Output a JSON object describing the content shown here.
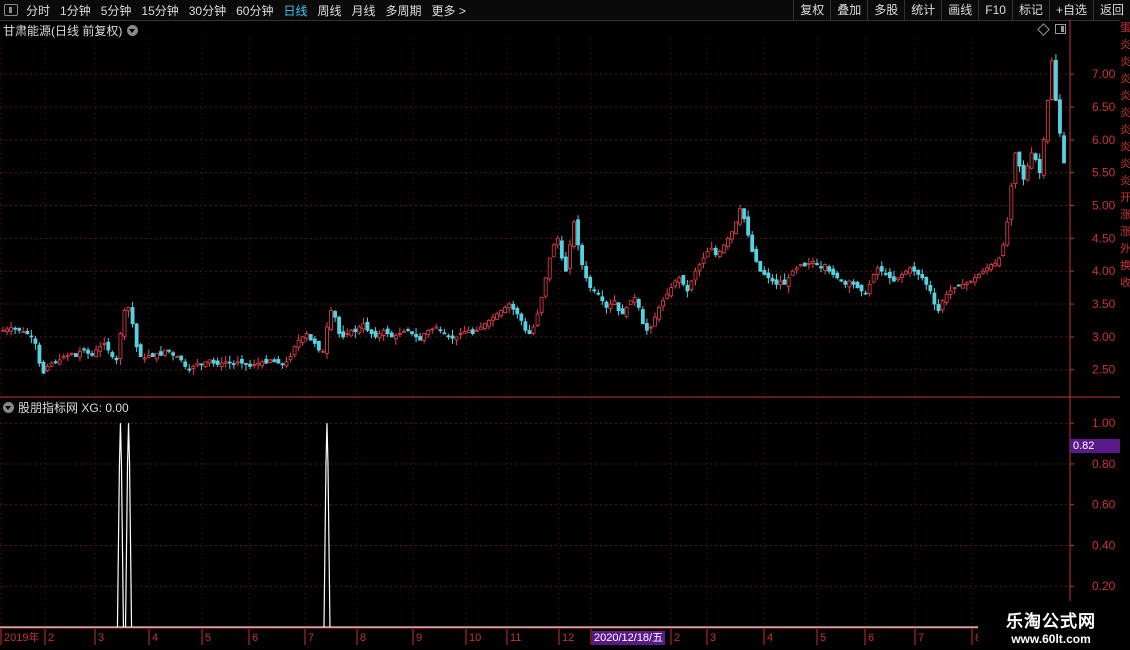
{
  "toolbar": {
    "periods": [
      "分时",
      "1分钟",
      "5分钟",
      "15分钟",
      "30分钟",
      "60分钟",
      "日线",
      "周线",
      "月线",
      "多周期",
      "更多 >"
    ],
    "active_period": "日线",
    "right_buttons": [
      "复权",
      "叠加",
      "多股",
      "统计",
      "画线",
      "F10",
      "标记",
      "+自选",
      "返回"
    ]
  },
  "main_chart": {
    "title": "甘肃能源(日线 前复权)"
  },
  "indicator": {
    "title": "股朋指标网  XG: 0.00",
    "marker_value": "0.82"
  },
  "date_highlight": "2020/12/18/五",
  "watermark": {
    "line1": "乐淘公式网",
    "line2": "www.60lt.com"
  },
  "colors": {
    "up": "#e8414a",
    "down": "#56d1e0",
    "axis": "#c83232",
    "grid": "#5a1414",
    "active_tab": "#37c8f0",
    "signal": "#ffffff"
  },
  "right_strip_chars": [
    "蛋",
    "炎",
    "炎",
    "炎",
    "炎",
    "炎",
    "炎",
    "炎",
    "炎",
    "炎",
    "开",
    "涨",
    "涨",
    "外",
    "换",
    "收"
  ],
  "chart_data": [
    {
      "type": "candlestick",
      "title": "甘肃能源(日线 前复权)",
      "y_ticks": [
        "2.50",
        "3.00",
        "3.50",
        "4.00",
        "4.50",
        "5.00",
        "5.50",
        "6.00",
        "6.50",
        "7.00"
      ],
      "ylim": [
        2.1,
        7.55
      ],
      "x_ticks": [
        "2019年",
        "2",
        "3",
        "4",
        "5",
        "6",
        "7",
        "8",
        "9",
        "10",
        "11",
        "12",
        "2020/12/18/五",
        "2",
        "3",
        "4",
        "5",
        "6",
        "7",
        "8"
      ],
      "close_path": [
        3.1,
        3.12,
        3.14,
        3.12,
        3.1,
        3.08,
        3.05,
        3.0,
        2.9,
        2.6,
        2.45,
        2.55,
        2.6,
        2.62,
        2.65,
        2.7,
        2.72,
        2.75,
        2.7,
        2.78,
        2.8,
        2.75,
        2.72,
        2.8,
        2.85,
        2.9,
        2.8,
        2.7,
        2.65,
        3.05,
        3.4,
        3.45,
        3.2,
        2.85,
        2.7,
        2.68,
        2.72,
        2.7,
        2.75,
        2.72,
        2.8,
        2.78,
        2.72,
        2.7,
        2.65,
        2.55,
        2.5,
        2.55,
        2.6,
        2.58,
        2.62,
        2.65,
        2.6,
        2.58,
        2.6,
        2.62,
        2.6,
        2.58,
        2.62,
        2.6,
        2.58,
        2.55,
        2.58,
        2.6,
        2.62,
        2.6,
        2.65,
        2.62,
        2.6,
        2.58,
        2.62,
        2.7,
        2.85,
        2.95,
        3.0,
        3.05,
        2.95,
        2.9,
        2.8,
        2.78,
        3.15,
        3.4,
        3.3,
        3.05,
        3.0,
        3.05,
        3.1,
        3.08,
        3.15,
        3.2,
        3.1,
        3.05,
        3.0,
        3.05,
        3.1,
        3.05,
        3.0,
        3.02,
        3.05,
        3.08,
        3.1,
        3.05,
        3.0,
        2.95,
        3.05,
        3.1,
        3.12,
        3.15,
        3.1,
        3.05,
        3.0,
        2.98,
        3.0,
        3.05,
        3.08,
        3.1,
        3.05,
        3.1,
        3.15,
        3.2,
        3.25,
        3.3,
        3.35,
        3.4,
        3.45,
        3.5,
        3.42,
        3.35,
        3.25,
        3.1,
        3.05,
        3.15,
        3.35,
        3.6,
        3.9,
        4.2,
        4.4,
        4.5,
        4.2,
        4.0,
        4.4,
        4.75,
        4.4,
        4.1,
        3.9,
        3.75,
        3.7,
        3.65,
        3.55,
        3.45,
        3.5,
        3.55,
        3.4,
        3.35,
        3.45,
        3.55,
        3.6,
        3.45,
        3.2,
        3.1,
        3.15,
        3.3,
        3.45,
        3.55,
        3.65,
        3.75,
        3.85,
        3.9,
        3.8,
        3.7,
        3.85,
        4.0,
        4.1,
        4.2,
        4.3,
        4.35,
        4.25,
        4.3,
        4.4,
        4.5,
        4.6,
        4.75,
        4.95,
        4.8,
        4.55,
        4.3,
        4.15,
        4.0,
        3.95,
        3.9,
        3.85,
        3.8,
        3.85,
        3.8,
        3.9,
        4.0,
        4.05,
        4.1,
        4.08,
        4.12,
        4.15,
        4.1,
        4.05,
        4.1,
        4.0,
        3.95,
        3.9,
        3.85,
        3.8,
        3.85,
        3.8,
        3.75,
        3.7,
        3.65,
        3.8,
        3.95,
        4.05,
        4.0,
        3.95,
        3.9,
        3.85,
        3.9,
        3.95,
        4.0,
        4.05,
        4.0,
        3.95,
        3.9,
        3.8,
        3.7,
        3.5,
        3.4,
        3.55,
        3.65,
        3.7,
        3.75,
        3.78,
        3.8,
        3.82,
        3.85,
        3.9,
        3.95,
        4.0,
        4.05,
        4.1,
        4.12,
        4.2,
        4.4,
        4.75,
        5.3,
        5.8,
        5.6,
        5.4,
        5.6,
        5.8,
        5.7,
        5.5,
        6.0,
        6.6,
        7.2,
        6.6,
        6.1,
        5.65
      ],
      "up_color": "#e8414a",
      "down_color": "#56d1e0",
      "grid": true
    },
    {
      "type": "line",
      "title": "股朋指标网  XG: 0.00",
      "series_name": "XG",
      "y_ticks": [
        "0.20",
        "0.40",
        "0.60",
        "0.80",
        "1.00"
      ],
      "ylim": [
        0,
        1.05
      ],
      "spike_bar_indices": [
        29,
        31,
        80
      ],
      "spike_value": 1.0,
      "baseline_value": 0.0,
      "marker_value": 0.82
    }
  ]
}
